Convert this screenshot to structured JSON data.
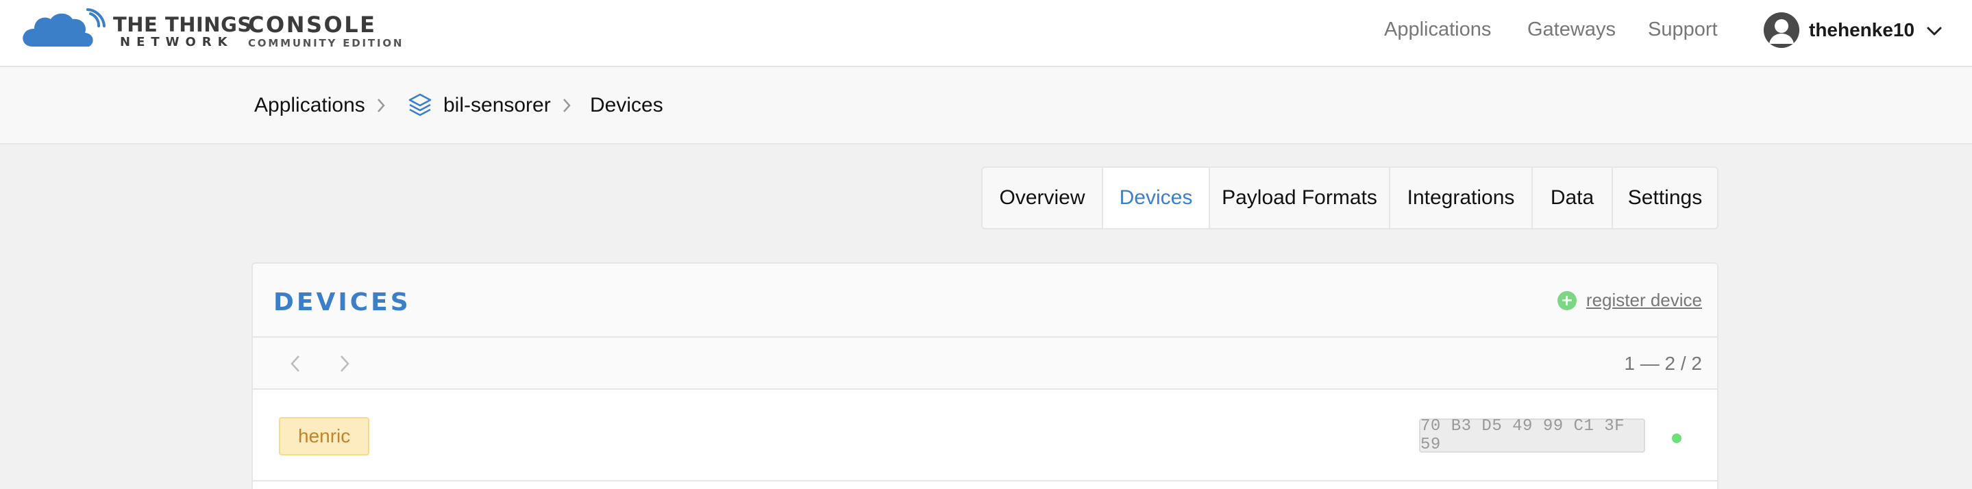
{
  "header": {
    "brand_line1": "THE THINGS",
    "brand_line2": "NETWORK",
    "console_title": "CONSOLE",
    "console_subtitle": "COMMUNITY EDITION",
    "nav": [
      {
        "label": "Applications"
      },
      {
        "label": "Gateways"
      },
      {
        "label": "Support"
      }
    ],
    "user": {
      "name": "thehenke10",
      "icon": "user-avatar-icon"
    }
  },
  "breadcrumb": {
    "items": [
      {
        "label": "Applications"
      },
      {
        "label": "bil-sensorer",
        "icon": "layers-icon"
      },
      {
        "label": "Devices"
      }
    ]
  },
  "tabs": [
    {
      "label": "Overview",
      "active": false
    },
    {
      "label": "Devices",
      "active": true
    },
    {
      "label": "Payload Formats",
      "active": false
    },
    {
      "label": "Integrations",
      "active": false
    },
    {
      "label": "Data",
      "active": false
    },
    {
      "label": "Settings",
      "active": false
    }
  ],
  "devices_panel": {
    "title": "DEVICES",
    "register_label": "register device",
    "pagination": {
      "range": "1 — 2 / 2"
    },
    "rows": [
      {
        "device_id": "henric",
        "dev_eui": "70 B3 D5 49 99 C1 3F 59",
        "status": "online"
      }
    ]
  },
  "colors": {
    "accent": "#3a7fc8",
    "tag_bg": "#fdecbf",
    "tag_text": "#c4832a",
    "status_online": "#6ee07a",
    "register_plus": "#7bd783"
  }
}
